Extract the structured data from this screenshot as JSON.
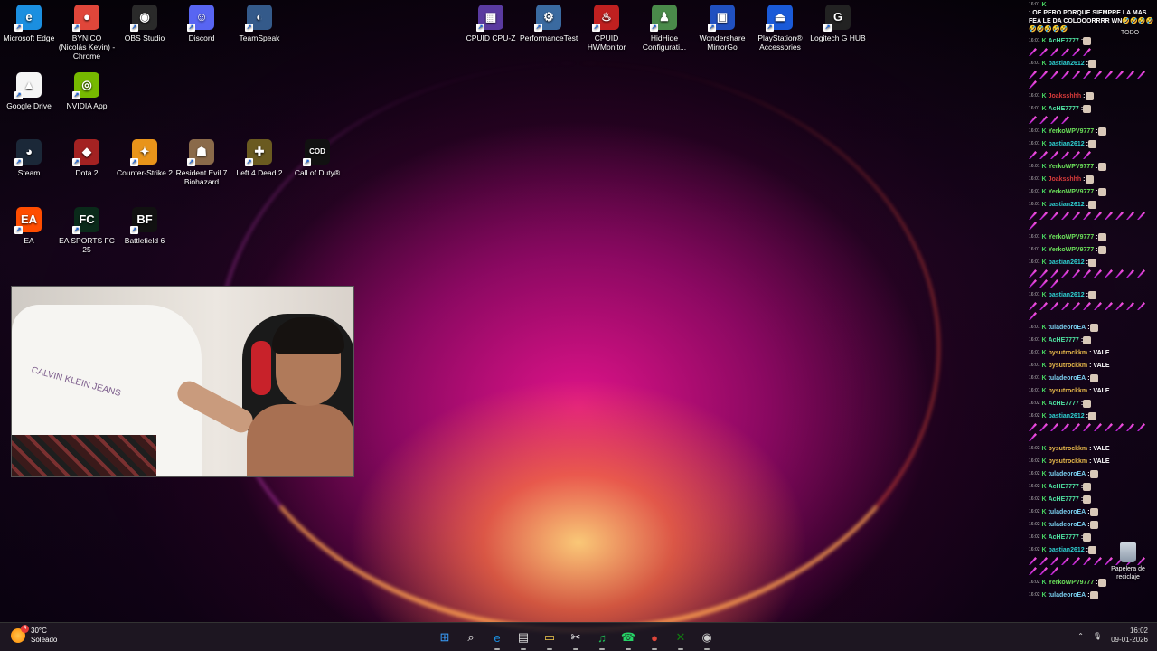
{
  "desktop": {
    "icons": [
      {
        "label": "Microsoft Edge",
        "icon": "edge-icon",
        "color": "#1b8fe0",
        "glyph": "e"
      },
      {
        "label": "BYNICO (Nicolás Kevin) - Chrome",
        "icon": "chrome-icon",
        "color": "#e0463a",
        "glyph": "●"
      },
      {
        "label": "OBS Studio",
        "icon": "obs-icon",
        "color": "#2a2a2a",
        "glyph": "◉"
      },
      {
        "label": "Discord",
        "icon": "discord-icon",
        "color": "#5865f2",
        "glyph": "☺"
      },
      {
        "label": "TeamSpeak",
        "icon": "teamspeak-icon",
        "color": "#345a8a",
        "glyph": "◐"
      },
      {
        "label": "Google Drive",
        "icon": "google-drive-icon",
        "color": "#f5f5f5",
        "glyph": "▲"
      },
      {
        "label": "NVIDIA App",
        "icon": "nvidia-icon",
        "color": "#76b900",
        "glyph": "◎"
      },
      {
        "label": "Steam",
        "icon": "steam-icon",
        "color": "#1b2838",
        "glyph": "◕"
      },
      {
        "label": "Dota 2",
        "icon": "dota2-icon",
        "color": "#a32222",
        "glyph": "◆"
      },
      {
        "label": "Counter-Strike 2",
        "icon": "cs2-icon",
        "color": "#e8941a",
        "glyph": "✦"
      },
      {
        "label": "Resident Evil 7 Biohazard",
        "icon": "re7-icon",
        "color": "#8a6a4a",
        "glyph": "☗"
      },
      {
        "label": "Left 4 Dead 2",
        "icon": "l4d2-icon",
        "color": "#6a5a20",
        "glyph": "✚"
      },
      {
        "label": "Call of Duty®",
        "icon": "cod-icon",
        "color": "#111111",
        "glyph": "COD"
      },
      {
        "label": "EA",
        "icon": "ea-icon",
        "color": "#ff4d00",
        "glyph": "EA"
      },
      {
        "label": "EA SPORTS FC 25",
        "icon": "fc25-icon",
        "color": "#0a2a1a",
        "glyph": "FC"
      },
      {
        "label": "Battlefield 6",
        "icon": "bf6-icon",
        "color": "#111111",
        "glyph": "BF"
      },
      {
        "label": "CPUID CPU-Z",
        "icon": "cpuz-icon",
        "color": "#5a3aa0",
        "glyph": "▦"
      },
      {
        "label": "PerformanceTest",
        "icon": "performancetest-icon",
        "color": "#3a6aa0",
        "glyph": "⚙"
      },
      {
        "label": "CPUID HWMonitor",
        "icon": "hwmonitor-icon",
        "color": "#c02020",
        "glyph": "♨"
      },
      {
        "label": "HidHide Configurati...",
        "icon": "hidhide-icon",
        "color": "#4a8a4a",
        "glyph": "♟"
      },
      {
        "label": "Wondershare MirrorGo",
        "icon": "mirrorgo-icon",
        "color": "#2050c0",
        "glyph": "▣"
      },
      {
        "label": "PlayStation® Accessories",
        "icon": "playstation-icon",
        "color": "#1a5ad8",
        "glyph": "⏏"
      },
      {
        "label": "Logitech G HUB",
        "icon": "logitech-ghub-icon",
        "color": "#222222",
        "glyph": "G"
      }
    ],
    "recycle_bin_label": "Papelera de reciclaje",
    "todo_label": "TODO"
  },
  "chat": {
    "lines": [
      {
        "time": "16:01",
        "user": "",
        "color": "#ff5a5a",
        "msg": ": OE PERO PORQUE SIEMPRE LA MAS FEA LE DA COLOOORRRR WN🤣🤣🤣🤣🤣🤣🤣🤣🤣",
        "emotes": 0
      },
      {
        "time": "16:01",
        "user": "AcHE7777",
        "color": "#4ee0a0",
        "msg": ":",
        "emotes": 6
      },
      {
        "time": "16:01",
        "user": "bastian2612",
        "color": "#2ed1d1",
        "msg": ":",
        "emotes": 12
      },
      {
        "time": "16:01",
        "user": "Joaksshhh",
        "color": "#d83a3a",
        "msg": ":",
        "emotes": 0
      },
      {
        "time": "16:01",
        "user": "AcHE7777",
        "color": "#4ee0a0",
        "msg": ":",
        "emotes": 4
      },
      {
        "time": "16:01",
        "user": "YerkoWPV9777",
        "color": "#6be05a",
        "msg": ":",
        "emotes": 0
      },
      {
        "time": "16:01",
        "user": "bastian2612",
        "color": "#2ed1d1",
        "msg": ":",
        "emotes": 6
      },
      {
        "time": "16:01",
        "user": "YerkoWPV9777",
        "color": "#6be05a",
        "msg": ":",
        "emotes": 0
      },
      {
        "time": "16:01",
        "user": "Joaksshhh",
        "color": "#d83a3a",
        "msg": ":",
        "emotes": 0
      },
      {
        "time": "16:01",
        "user": "YerkoWPV9777",
        "color": "#6be05a",
        "msg": ":",
        "emotes": 0
      },
      {
        "time": "16:01",
        "user": "bastian2612",
        "color": "#2ed1d1",
        "msg": ":",
        "emotes": 12
      },
      {
        "time": "16:01",
        "user": "YerkoWPV9777",
        "color": "#6be05a",
        "msg": ":",
        "emotes": 0
      },
      {
        "time": "16:01",
        "user": "YerkoWPV9777",
        "color": "#6be05a",
        "msg": ":",
        "emotes": 0
      },
      {
        "time": "16:01",
        "user": "bastian2612",
        "color": "#2ed1d1",
        "msg": ":",
        "emotes": 14
      },
      {
        "time": "16:01",
        "user": "bastian2612",
        "color": "#2ed1d1",
        "msg": ":",
        "emotes": 12
      },
      {
        "time": "16:01",
        "user": "tuladeoroEA",
        "color": "#7ad0f0",
        "msg": ":",
        "emotes": 0
      },
      {
        "time": "16:01",
        "user": "AcHE7777",
        "color": "#4ee0a0",
        "msg": ":",
        "emotes": 0
      },
      {
        "time": "16:01",
        "user": "bysutrockkm",
        "color": "#e6b84a",
        "msg": ": VALE",
        "emotes": 0
      },
      {
        "time": "16:01",
        "user": "bysutrockkm",
        "color": "#e6b84a",
        "msg": ": VALE",
        "emotes": 0
      },
      {
        "time": "16:01",
        "user": "tuladeoroEA",
        "color": "#7ad0f0",
        "msg": ":",
        "emotes": 0
      },
      {
        "time": "16:01",
        "user": "bysutrockkm",
        "color": "#e6b84a",
        "msg": ": VALE",
        "emotes": 0
      },
      {
        "time": "16:02",
        "user": "AcHE7777",
        "color": "#4ee0a0",
        "msg": ":",
        "emotes": 0
      },
      {
        "time": "16:02",
        "user": "bastian2612",
        "color": "#2ed1d1",
        "msg": ":",
        "emotes": 12
      },
      {
        "time": "16:02",
        "user": "bysutrockkm",
        "color": "#e6b84a",
        "msg": ": VALE",
        "emotes": 0
      },
      {
        "time": "16:02",
        "user": "bysutrockkm",
        "color": "#e6b84a",
        "msg": ": VALE",
        "emotes": 0
      },
      {
        "time": "16:02",
        "user": "tuladeoroEA",
        "color": "#7ad0f0",
        "msg": ":",
        "emotes": 0
      },
      {
        "time": "16:02",
        "user": "AcHE7777",
        "color": "#4ee0a0",
        "msg": ":",
        "emotes": 0
      },
      {
        "time": "16:02",
        "user": "AcHE7777",
        "color": "#4ee0a0",
        "msg": ":",
        "emotes": 0
      },
      {
        "time": "16:02",
        "user": "tuladeoroEA",
        "color": "#7ad0f0",
        "msg": ":",
        "emotes": 0
      },
      {
        "time": "16:02",
        "user": "tuladeoroEA",
        "color": "#7ad0f0",
        "msg": ":",
        "emotes": 0
      },
      {
        "time": "16:02",
        "user": "AcHE7777",
        "color": "#4ee0a0",
        "msg": ":",
        "emotes": 0
      },
      {
        "time": "16:02",
        "user": "bastian2612",
        "color": "#2ed1d1",
        "msg": ":",
        "emotes": 14
      },
      {
        "time": "16:02",
        "user": "YerkoWPV9777",
        "color": "#6be05a",
        "msg": ":",
        "emotes": 0
      },
      {
        "time": "16:02",
        "user": "tuladeoroEA",
        "color": "#7ad0f0",
        "msg": ":",
        "emotes": 0
      }
    ]
  },
  "taskbar": {
    "weather_temp": "30°C",
    "weather_desc": "Soleado",
    "weather_badge": "4",
    "apps": [
      {
        "name": "start-button",
        "glyph": "⊞",
        "color": "#3aa0ff"
      },
      {
        "name": "search-button",
        "glyph": "⌕",
        "color": "#ffffff"
      },
      {
        "name": "edge-taskbar",
        "glyph": "e",
        "color": "#1b8fe0"
      },
      {
        "name": "store-taskbar",
        "glyph": "▤",
        "color": "#e0e0e0"
      },
      {
        "name": "explorer-taskbar",
        "glyph": "▭",
        "color": "#f2c94c"
      },
      {
        "name": "snipping-taskbar",
        "glyph": "✂",
        "color": "#ffffff"
      },
      {
        "name": "spotify-taskbar",
        "glyph": "♫",
        "color": "#1db954"
      },
      {
        "name": "whatsapp-taskbar",
        "glyph": "☎",
        "color": "#25d366"
      },
      {
        "name": "chrome-taskbar",
        "glyph": "●",
        "color": "#e0463a"
      },
      {
        "name": "xbox-taskbar",
        "glyph": "✕",
        "color": "#107c10"
      },
      {
        "name": "obs-taskbar",
        "glyph": "◉",
        "color": "#cccccc"
      }
    ],
    "tray_date": "09-01-2026",
    "tray_time": "16:02"
  }
}
